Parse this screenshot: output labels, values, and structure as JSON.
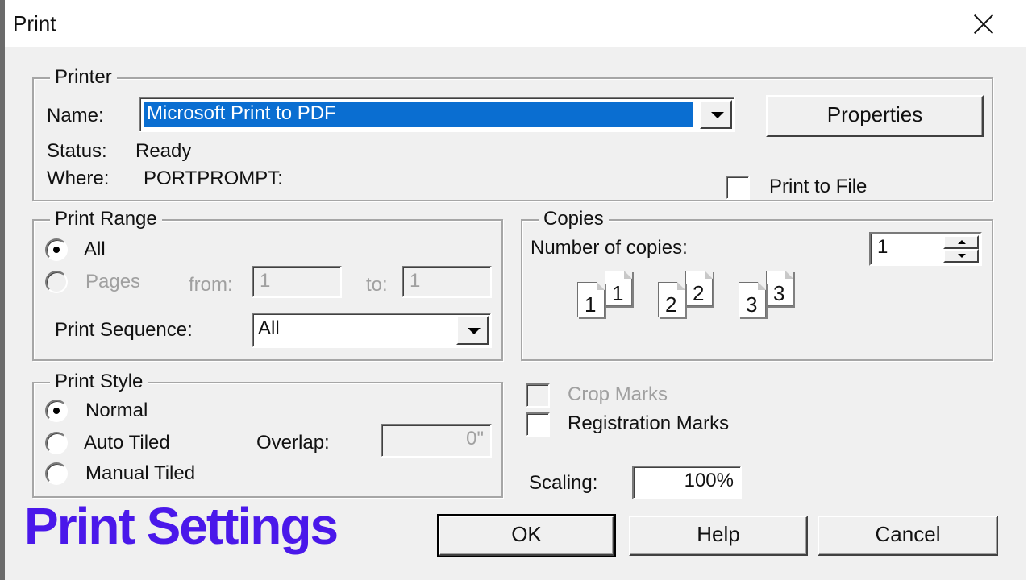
{
  "dialog": {
    "title": "Print"
  },
  "printer": {
    "group_label": "Printer",
    "name_label": "Name:",
    "name_value": "Microsoft Print to PDF",
    "properties_button": "Properties",
    "status_label": "Status:",
    "status_value": "Ready",
    "where_label": "Where:",
    "where_value": "PORTPROMPT:",
    "print_to_file_label": "Print to File",
    "print_to_file_checked": false
  },
  "print_range": {
    "group_label": "Print Range",
    "all_label": "All",
    "pages_label": "Pages",
    "from_label": "from:",
    "from_value": "1",
    "to_label": "to:",
    "to_value": "1",
    "sequence_label": "Print Sequence:",
    "sequence_value": "All",
    "selected": "All"
  },
  "copies": {
    "group_label": "Copies",
    "number_label": "Number of copies:",
    "number_value": "1",
    "collate_pages": [
      "1",
      "1",
      "2",
      "2",
      "3",
      "3"
    ]
  },
  "print_style": {
    "group_label": "Print Style",
    "normal_label": "Normal",
    "auto_tiled_label": "Auto Tiled",
    "manual_tiled_label": "Manual Tiled",
    "overlap_label": "Overlap:",
    "overlap_value": "0\"",
    "selected": "Normal"
  },
  "marks": {
    "crop_marks_label": "Crop Marks",
    "crop_marks_checked": false,
    "registration_marks_label": "Registration Marks",
    "registration_marks_checked": false
  },
  "scaling": {
    "label": "Scaling:",
    "value": "100%"
  },
  "buttons": {
    "ok": "OK",
    "help": "Help",
    "cancel": "Cancel"
  },
  "overlay": {
    "title": "Print Settings",
    "color": "#4a18ea"
  },
  "colors": {
    "selection": "#0a6ed1",
    "dialog_bg": "#f0f0f0",
    "disabled_text": "#a0a0a0"
  }
}
